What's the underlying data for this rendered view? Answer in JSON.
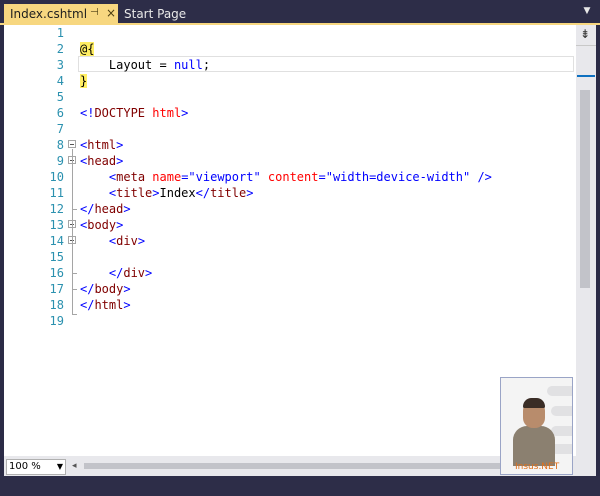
{
  "tabs": {
    "active": {
      "label": "Index.cshtml",
      "pin_icon": "pin-icon",
      "close_icon": "close-icon"
    },
    "inactive": {
      "label": "Start Page"
    },
    "dropdown_icon": "chevron-down-icon"
  },
  "editor": {
    "lines": [
      {
        "num": "1"
      },
      {
        "num": "2"
      },
      {
        "num": "3"
      },
      {
        "num": "4"
      },
      {
        "num": "5"
      },
      {
        "num": "6"
      },
      {
        "num": "7"
      },
      {
        "num": "8"
      },
      {
        "num": "9"
      },
      {
        "num": "10"
      },
      {
        "num": "11"
      },
      {
        "num": "12"
      },
      {
        "num": "13"
      },
      {
        "num": "14"
      },
      {
        "num": "15"
      },
      {
        "num": "16"
      },
      {
        "num": "17"
      },
      {
        "num": "18"
      },
      {
        "num": "19"
      }
    ],
    "tokens": {
      "l2_razor": "@{",
      "l3_text": "Layout = ",
      "l3_null": "null",
      "l3_semi": ";",
      "l4_razor": "}",
      "l6_open": "<!",
      "l6_name": "DOCTYPE",
      "l6_attr": "html",
      "l6_close": ">",
      "l8": "html",
      "l9": "head",
      "l10_tag": "meta",
      "l10_a1": "name",
      "l10_v1": "\"viewport\"",
      "l10_a2": "content",
      "l10_v2": "\"width=device-width\"",
      "l10_end": " />",
      "l11_tag": "title",
      "l11_text": "Index",
      "l12": "head",
      "l13": "body",
      "l14": "div",
      "l16": "div",
      "l17": "body",
      "l18": "html"
    }
  },
  "statusbar": {
    "zoom": "100 %",
    "zoom_arrow_icon": "dropdown-arrow-icon"
  },
  "watermark": {
    "label": "Insus.NET"
  },
  "colors": {
    "tab_active": "#f7d780",
    "line_numbers": "#2b91af",
    "html_tag": "#800000",
    "attribute": "#ff0000",
    "string": "#0000ff",
    "razor_highlight": "#ffee62"
  }
}
